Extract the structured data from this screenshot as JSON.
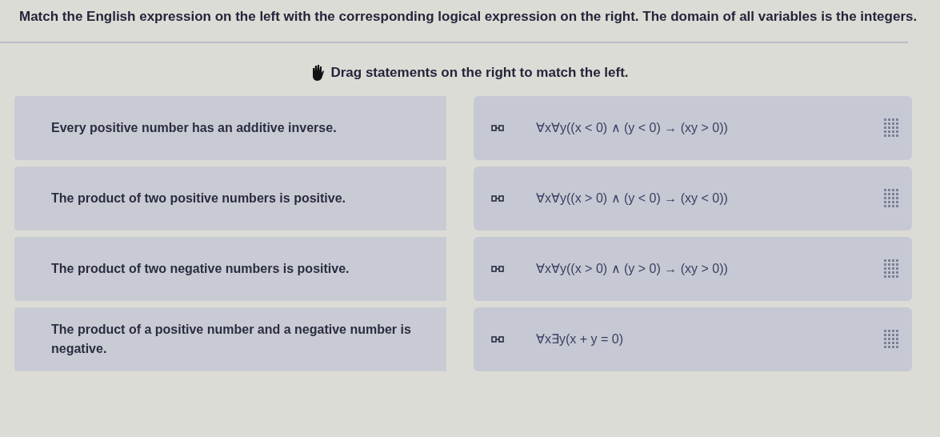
{
  "question": "Match the English expression on the left with the corresponding logical expression on the right. The domain of all variables is the integers.",
  "instruction": "Drag statements on the right to match the left.",
  "pairs": [
    {
      "prompt": "Every positive number has an additive inverse.",
      "statement": "∀x∀y((x < 0) ∧ (y < 0) → (xy > 0))"
    },
    {
      "prompt": "The product of two positive numbers is positive.",
      "statement": "∀x∀y((x > 0) ∧ (y < 0) → (xy < 0))"
    },
    {
      "prompt": "The product of two negative numbers is positive.",
      "statement": "∀x∀y((x > 0) ∧ (y > 0) → (xy > 0))"
    },
    {
      "prompt": "The product of a positive number and a negative number is negative.",
      "statement": "∀x∃y(x + y = 0)"
    }
  ]
}
